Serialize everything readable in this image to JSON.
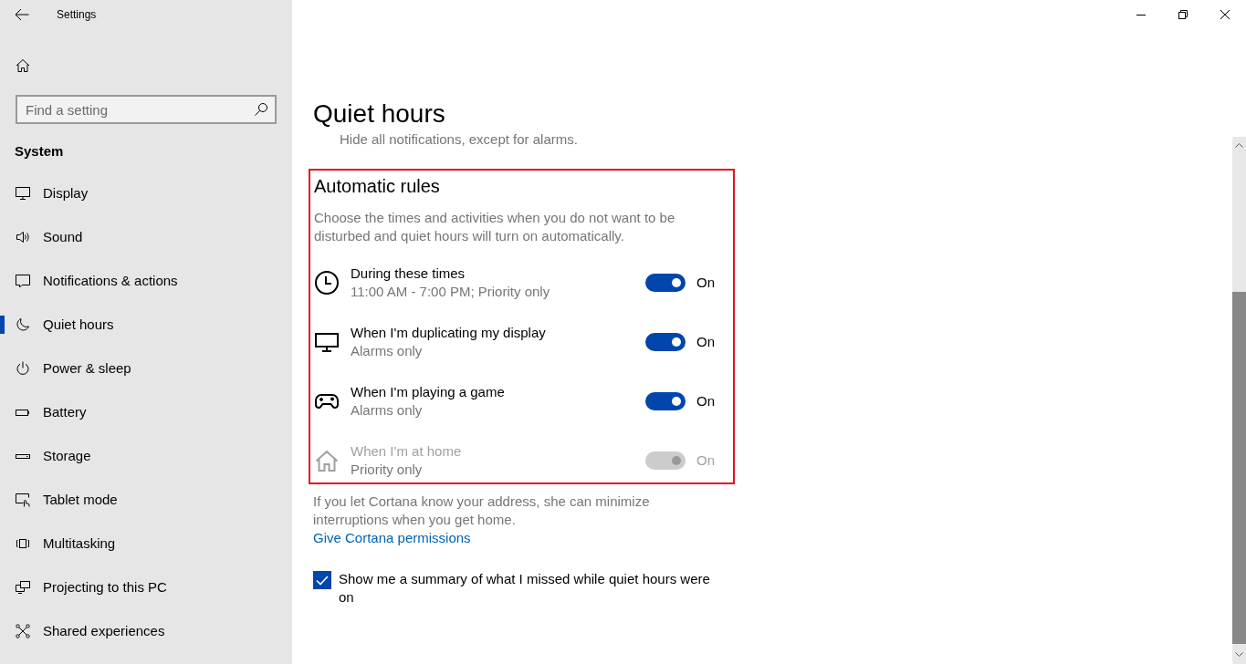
{
  "window": {
    "title": "Settings"
  },
  "sidebar": {
    "search": {
      "placeholder": "Find a setting"
    },
    "section": "System",
    "items": [
      {
        "label": "Display",
        "selected": false
      },
      {
        "label": "Sound",
        "selected": false
      },
      {
        "label": "Notifications & actions",
        "selected": false
      },
      {
        "label": "Quiet hours",
        "selected": true
      },
      {
        "label": "Power & sleep",
        "selected": false
      },
      {
        "label": "Battery",
        "selected": false
      },
      {
        "label": "Storage",
        "selected": false
      },
      {
        "label": "Tablet mode",
        "selected": false
      },
      {
        "label": "Multitasking",
        "selected": false
      },
      {
        "label": "Projecting to this PC",
        "selected": false
      },
      {
        "label": "Shared experiences",
        "selected": false
      }
    ]
  },
  "page": {
    "title": "Quiet hours",
    "intro": "Hide all notifications, except for alarms."
  },
  "automatic_rules": {
    "title": "Automatic rules",
    "description": "Choose the times and activities when you do not want to be disturbed and quiet hours will turn on automatically.",
    "rules": [
      {
        "title": "During these times",
        "subtitle": "11:00 AM - 7:00 PM; Priority only",
        "on": true,
        "disabled": false,
        "state": "On"
      },
      {
        "title": "When I'm duplicating my display",
        "subtitle": "Alarms only",
        "on": true,
        "disabled": false,
        "state": "On"
      },
      {
        "title": "When I'm playing a game",
        "subtitle": "Alarms only",
        "on": true,
        "disabled": false,
        "state": "On"
      },
      {
        "title": "When I'm at home",
        "subtitle": "Priority only",
        "on": true,
        "disabled": true,
        "state": "On"
      }
    ]
  },
  "cortana": {
    "text": "If you let Cortana know your address, she can minimize interruptions when you get home.",
    "link": "Give Cortana permissions"
  },
  "summary": {
    "label": "Show me a summary of what I missed while quiet hours were on",
    "checked": true
  }
}
